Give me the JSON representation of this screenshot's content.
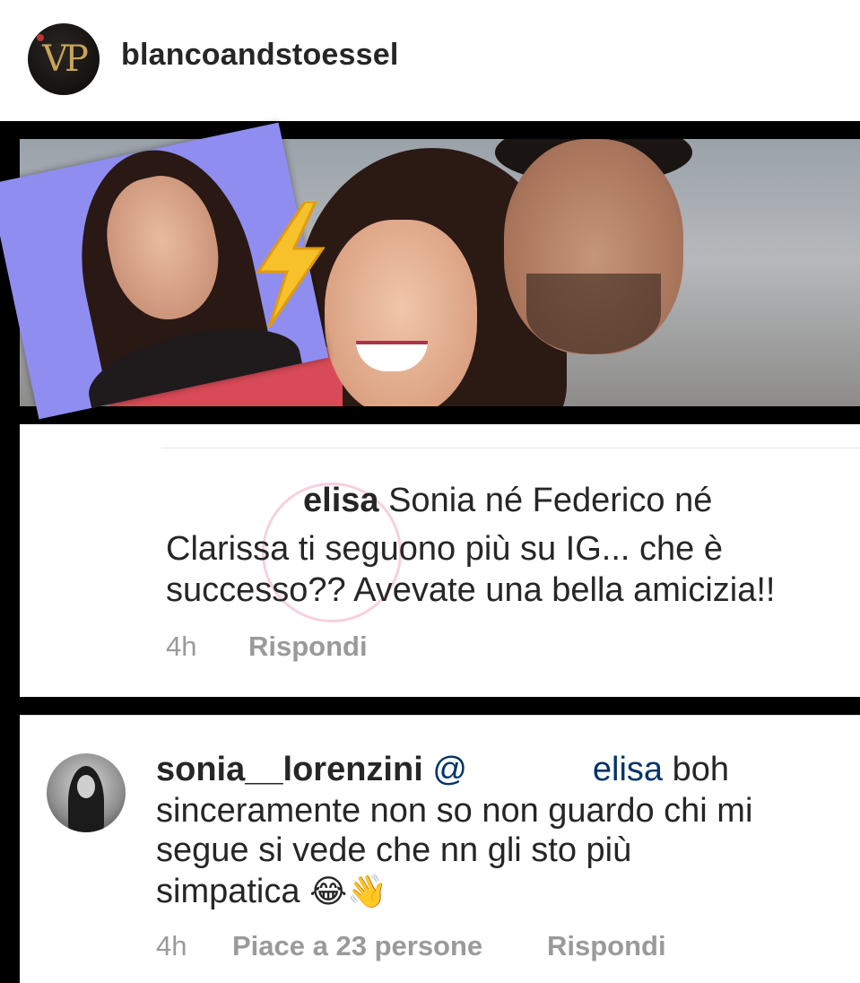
{
  "post": {
    "username": "blancoandstoessel",
    "avatar_monogram": "VP"
  },
  "comment1": {
    "username": "elisa",
    "line1": " Sonia né Federico né",
    "line2": "Clarissa ti seguono più su IG... che è",
    "line3": "successo?? Avevate una bella amicizia!!",
    "time": "4h",
    "reply": "Rispondi"
  },
  "comment2": {
    "username": "sonia__lorenzini",
    "mention_at": "@",
    "mention": "elisa",
    "line1_after": " boh",
    "line2": "sinceramente non so non guardo chi mi",
    "line3": "segue si vede che nn gli sto più",
    "line4": "simpatica ",
    "emoji1": "😂",
    "emoji2": "👋",
    "time": "4h",
    "likes": "Piace a 23 persone",
    "reply": "Rispondi"
  },
  "icons": {
    "bolt": "lightning-icon"
  }
}
